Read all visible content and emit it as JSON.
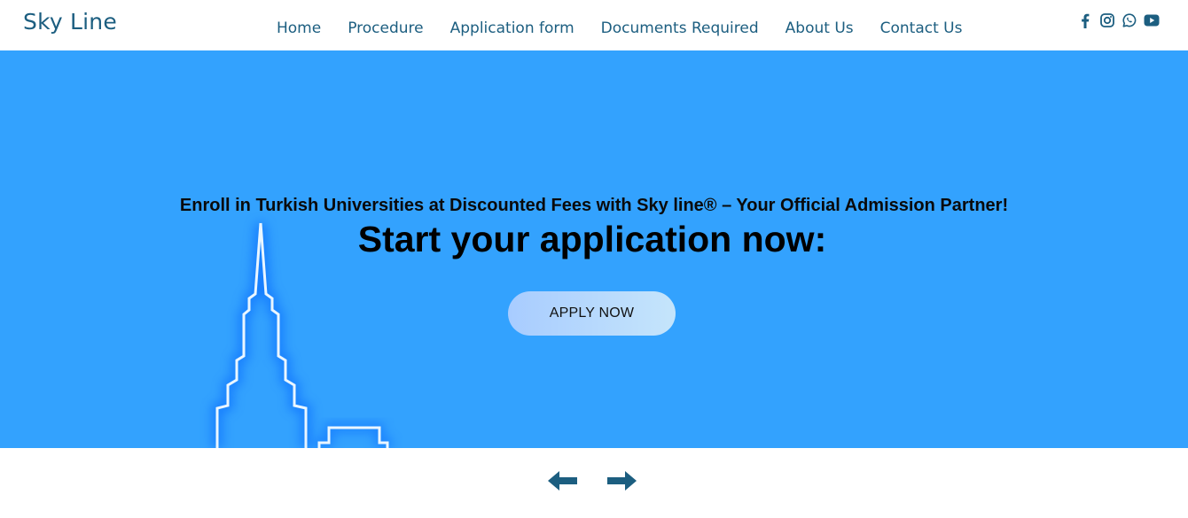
{
  "brand": "Sky Line",
  "nav": {
    "items": [
      {
        "label": "Home"
      },
      {
        "label": "Procedure"
      },
      {
        "label": "Application form"
      },
      {
        "label": "Documents Required"
      },
      {
        "label": "About Us"
      },
      {
        "label": "Contact Us"
      }
    ]
  },
  "social": [
    "facebook-icon",
    "instagram-icon",
    "whatsapp-icon",
    "youtube-icon"
  ],
  "hero": {
    "tagline": "Enroll in Turkish Universities at Discounted Fees with Sky line® – Your Official Admission Partner!",
    "headline": "Start your application now:",
    "cta": "APPLY NOW"
  },
  "carousel": {
    "prev_icon": "arrow-left-icon",
    "next_icon": "arrow-right-icon"
  },
  "colors": {
    "brand": "#1c5e80",
    "hero_bg": "#33a2fe",
    "button_gradient_start": "#a8ccff",
    "button_gradient_end": "#c5e5fb"
  }
}
